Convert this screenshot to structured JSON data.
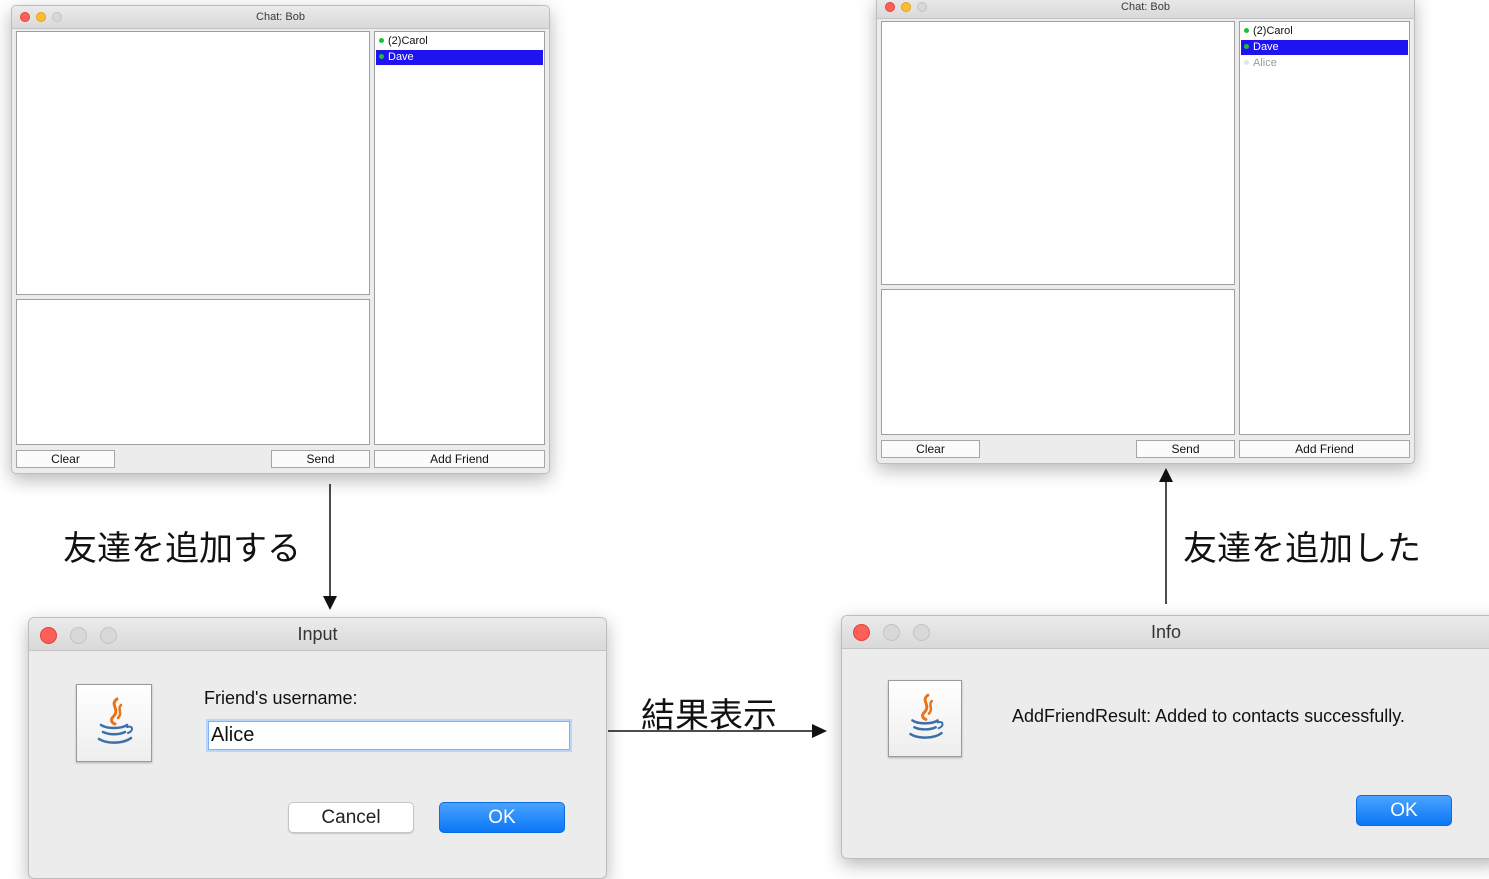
{
  "chat_before": {
    "title": "Chat: Bob",
    "contacts": [
      {
        "label": "(2)Carol",
        "status": "online"
      },
      {
        "label": "Dave",
        "status": "online",
        "selected": true
      }
    ],
    "buttons": {
      "clear": "Clear",
      "send": "Send",
      "add_friend": "Add Friend"
    }
  },
  "chat_after": {
    "title": "Chat: Bob",
    "contacts": [
      {
        "label": "(2)Carol",
        "status": "online"
      },
      {
        "label": "Dave",
        "status": "online",
        "selected": true
      },
      {
        "label": "Alice",
        "status": "offline"
      }
    ],
    "buttons": {
      "clear": "Clear",
      "send": "Send",
      "add_friend": "Add Friend"
    }
  },
  "input_dialog": {
    "title": "Input",
    "prompt": "Friend's username:",
    "value": "Alice",
    "cancel_label": "Cancel",
    "ok_label": "OK"
  },
  "info_dialog": {
    "title": "Info",
    "message": "AddFriendResult: Added to contacts successfully.",
    "ok_label": "OK"
  },
  "flow_labels": {
    "add_friend": "友達を追加する",
    "show_result": "結果表示",
    "added_friend": "友達を追加した"
  },
  "colors": {
    "selection": "#1f14f0",
    "online": "#19c13a",
    "primary_button": "#0a77f6",
    "close_light": "#fe5f57",
    "minimize_light": "#febc2e"
  },
  "icons": {
    "dialog_icon": "java-coffee-cup-icon",
    "status_online": "green-dot-icon",
    "status_offline": "grey-dot-icon"
  }
}
